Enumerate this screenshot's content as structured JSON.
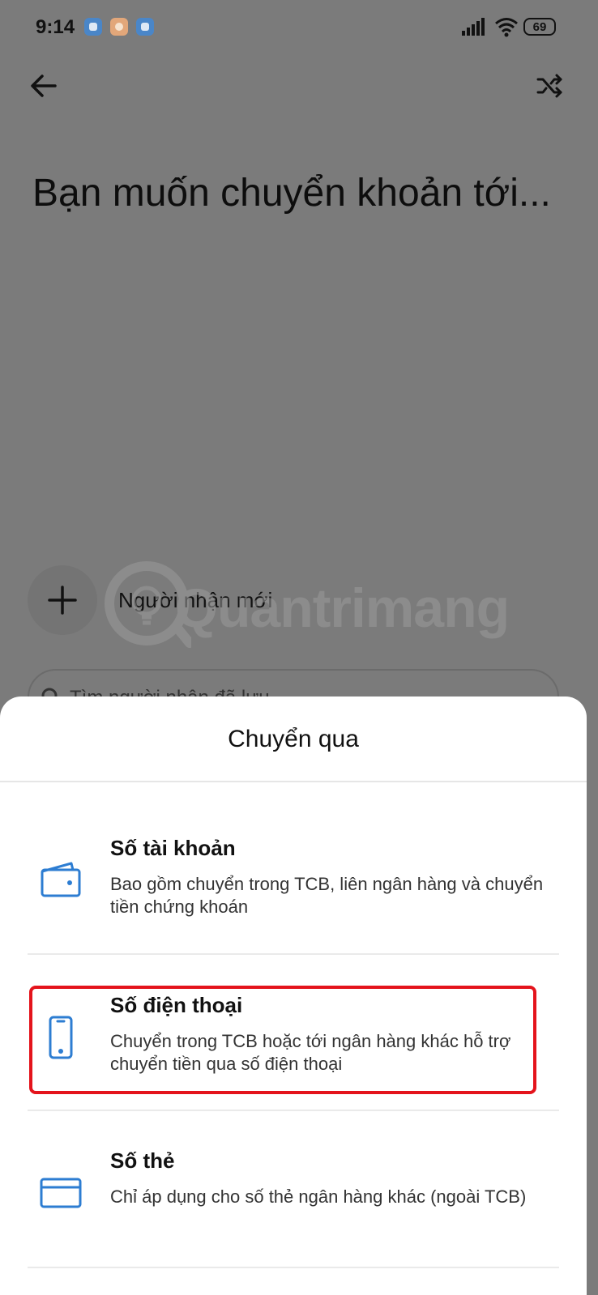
{
  "status_bar": {
    "time": "9:14",
    "battery": "69"
  },
  "header": {
    "headline": "Bạn muốn chuyển khoản tới..."
  },
  "recipient": {
    "new_label": "Người nhận mới",
    "search_placeholder": "Tìm người nhận đã lưu"
  },
  "watermark": {
    "text": "Quantrimang"
  },
  "sheet": {
    "title": "Chuyển qua",
    "options": [
      {
        "title": "Số tài khoản",
        "description": "Bao gồm chuyển trong TCB, liên ngân hàng và chuyển tiền chứng khoán",
        "icon": "wallet-icon"
      },
      {
        "title": "Số điện thoại",
        "description": "Chuyển trong TCB hoặc tới ngân hàng khác hỗ trợ chuyển tiền qua số điện thoại",
        "icon": "phone-icon"
      },
      {
        "title": "Số thẻ",
        "description": "Chỉ áp dụng cho số thẻ ngân hàng khác (ngoài TCB)",
        "icon": "card-icon"
      }
    ]
  },
  "colors": {
    "accent": "#2d7dd2",
    "highlight": "#e4141c",
    "overlay": "#7b7b7b"
  }
}
